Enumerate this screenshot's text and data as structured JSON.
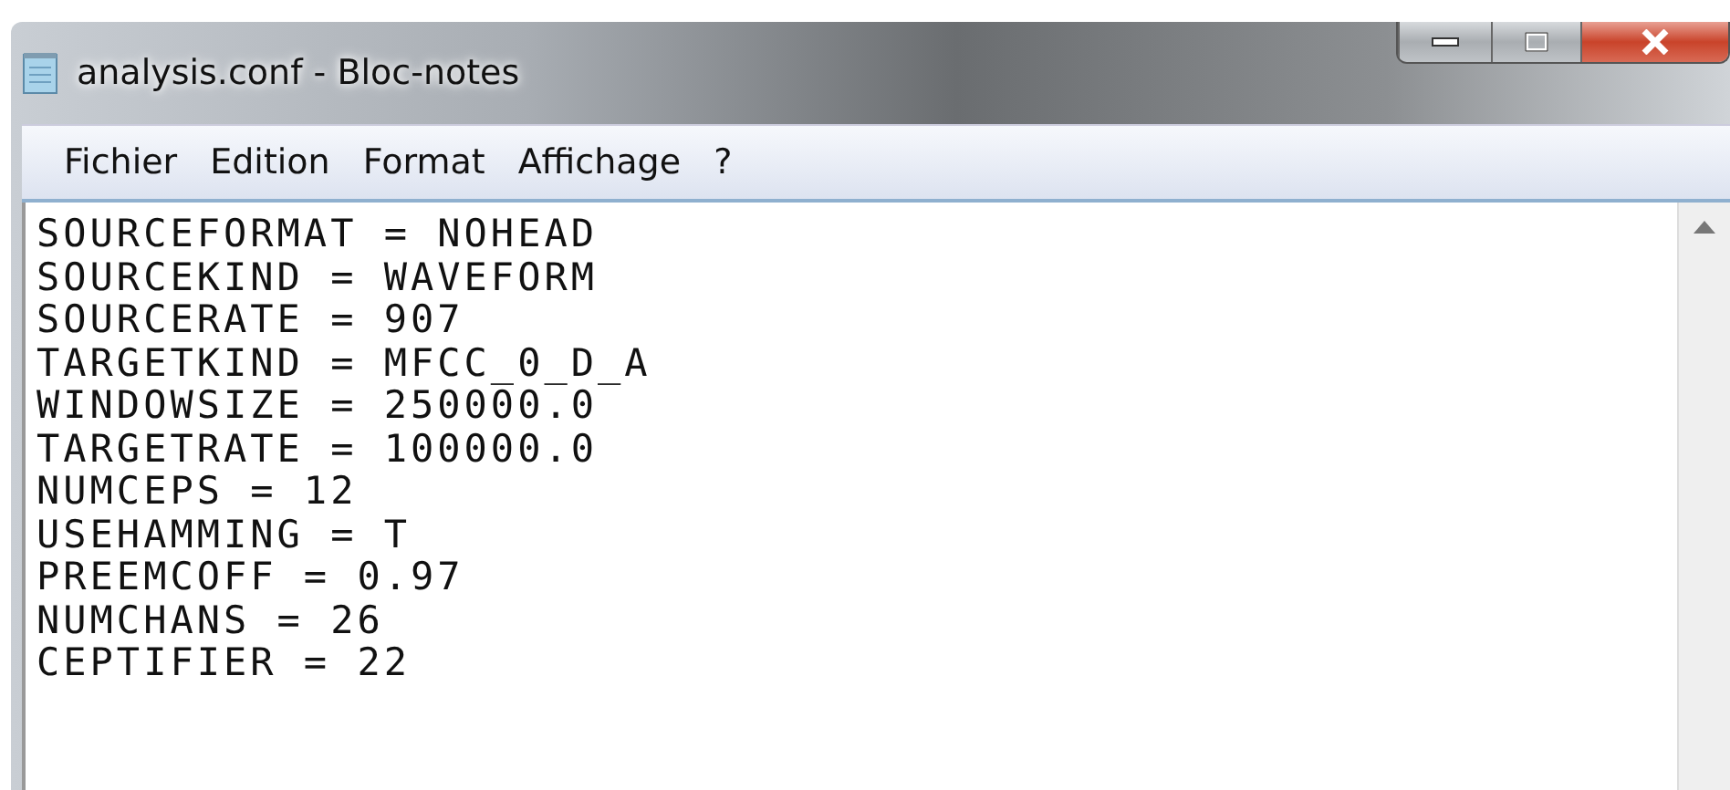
{
  "window": {
    "title": "analysis.conf - Bloc-notes"
  },
  "menu": [
    "Fichier",
    "Edition",
    "Format",
    "Affichage",
    "?"
  ],
  "lines": [
    "SOURCEFORMAT = NOHEAD",
    "SOURCEKIND = WAVEFORM",
    "SOURCERATE = 907",
    "TARGETKIND = MFCC_0_D_A",
    "WINDOWSIZE = 250000.0",
    "TARGETRATE = 100000.0",
    "NUMCEPS = 12",
    "USEHAMMING = T",
    "PREEMCOFF = 0.97",
    "NUMCHANS = 26",
    "CEPTIFIER = 22"
  ]
}
